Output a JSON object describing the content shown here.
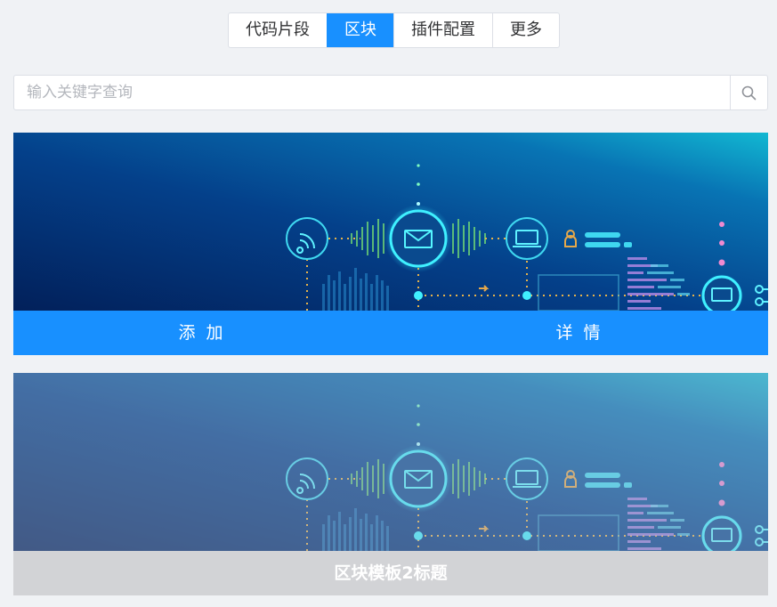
{
  "tabs": [
    {
      "label": "代码片段",
      "active": false
    },
    {
      "label": "区块",
      "active": true
    },
    {
      "label": "插件配置",
      "active": false
    },
    {
      "label": "更多",
      "active": false
    }
  ],
  "search": {
    "placeholder": "输入关键字查询",
    "value": "",
    "icon": "search-icon"
  },
  "cards": [
    {
      "image": "network-tech-banner",
      "actions": {
        "add": "添 加",
        "details": "详 情"
      }
    },
    {
      "image": "network-tech-banner",
      "title": "区块模板2标题"
    }
  ],
  "colors": {
    "accent": "#1890ff",
    "page_bg": "#f0f2f5",
    "muted_bar": "#d2d3d6"
  }
}
